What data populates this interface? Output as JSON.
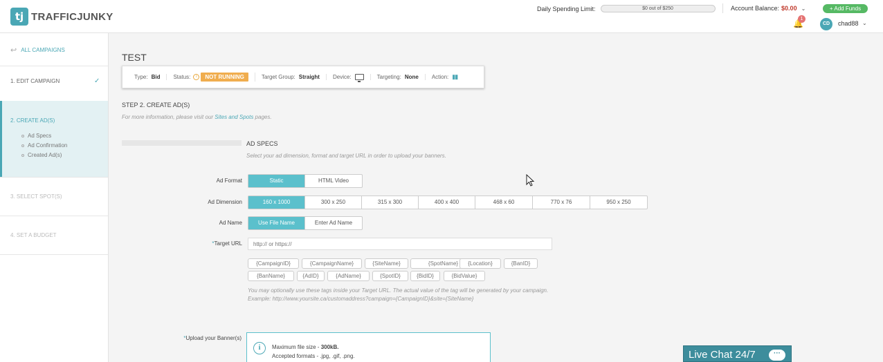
{
  "header": {
    "logo_mark": "tj",
    "logo_text": "TRAFFICJUNKY",
    "spend_label": "Daily Spending Limit:",
    "spend_value": "$0 out of $250",
    "balance_label": "Account Balance:",
    "balance_value": "$0.00",
    "add_funds": "+ Add Funds",
    "notification_count": "1",
    "avatar_initials": "CD",
    "username": "chad88"
  },
  "sidebar": {
    "all_campaigns": "ALL CAMPAIGNS",
    "step1": "1. EDIT CAMPAIGN",
    "step2": "2. CREATE AD(S)",
    "sub_items": [
      "Ad Specs",
      "Ad Confirmation",
      "Created Ad(s)"
    ],
    "step3": "3. SELECT SPOT(S)",
    "step4": "4. SET A BUDGET"
  },
  "main": {
    "title": "TEST",
    "info": {
      "type_label": "Type:",
      "type_value": "Bid",
      "status_label": "Status:",
      "status_value": "NOT RUNNING",
      "target_label": "Target Group:",
      "target_value": "Straight",
      "device_label": "Device:",
      "targeting_label": "Targeting:",
      "targeting_value": "None",
      "action_label": "Action:"
    },
    "step_title": "STEP 2. CREATE AD(S)",
    "step_info_prefix": "For more information, please visit our ",
    "step_info_link": "Sites and Spots",
    "step_info_suffix": " pages.",
    "specs_title": "AD SPECS",
    "specs_info": "Select your ad dimension, format and target URL in order to upload your banners.",
    "ad_format_label": "Ad Format",
    "ad_formats": [
      "Static",
      "HTML Video"
    ],
    "ad_dimension_label": "Ad Dimension",
    "ad_dimensions": [
      "160 x 1000",
      "300 x 250",
      "315 x 300",
      "400 x 400",
      "468 x 60",
      "770 x 76",
      "950 x 250"
    ],
    "ad_name_label": "Ad Name",
    "ad_name_options": [
      "Use File Name",
      "Enter Ad Name"
    ],
    "target_url_label": "Target URL",
    "target_url_placeholder": "http:// or https://",
    "tags_row1": [
      "{CampaignID}",
      "{CampaignName}",
      "{SiteName}",
      "{SpotName}",
      "{Location}",
      "{BanID}"
    ],
    "tags_row2": [
      "{BanName}",
      "{AdID}",
      "{AdName}",
      "{SpotID}",
      "{BidID}",
      "{BidValue}"
    ],
    "tag_note_1": "You may optionally use these tags inside your Target URL. The actual value of the tag will be generated by your campaign.",
    "tag_note_2": "Example: http://www.yoursite.ca/customaddress?campaign={CampaignID}&site={SiteName}",
    "upload_label": "Upload your Banner(s)",
    "upload_max_label": "Maximum file size - ",
    "upload_max_value": "300kB.",
    "upload_formats": "Accepted formats - .jpg, .gif, .png."
  },
  "livechat": {
    "label": "Live Chat 24/7",
    "bubble": "···"
  },
  "colors": {
    "accent": "#4aa7b5",
    "status_badge": "#f0ad4e",
    "add_funds": "#56b964",
    "balance": "#c0392b"
  }
}
